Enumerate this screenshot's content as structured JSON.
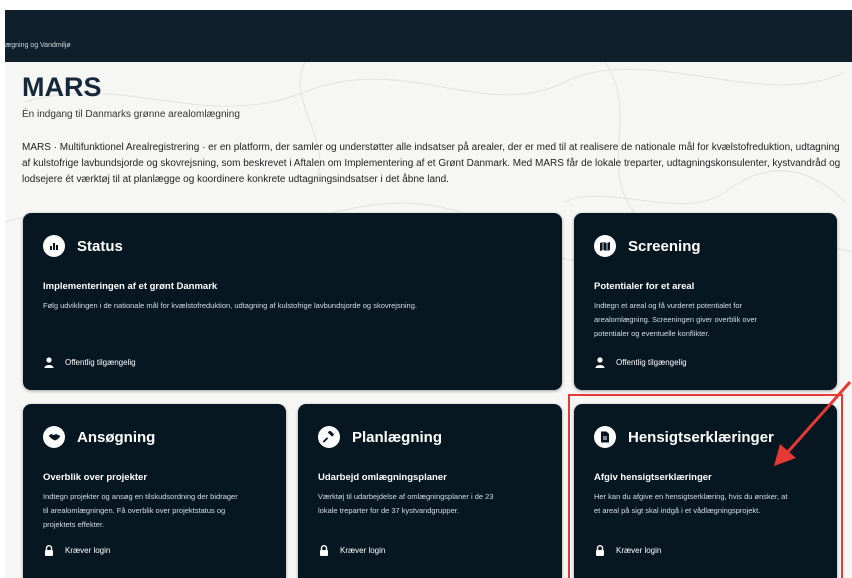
{
  "header": {
    "breadcrumb": "ægning og Vandmiljø"
  },
  "page": {
    "title": "MARS",
    "subtitle": "Én indgang til Danmarks grønne arealomlægning",
    "description": "MARS · Multifunktionel Arealregistrering · er en platform, der samler og understøtter alle indsatser på arealer, der er med til at realisere de nationale mål for kvælstofreduktion, udtagning af kulstofrige lavbundsjorde og skovrejsning, som beskrevet i Aftalen om Implementering af et Grønt Danmark. Med MARS får de lokale treparter, udtagningskonsulenter, kystvandråd og lodsejere ét værktøj til at planlægge og koordinere konkrete udtagningsindsatser i det åbne land."
  },
  "cards": {
    "status": {
      "title": "Status",
      "subtitle": "Implementeringen af et grønt Danmark",
      "body": "Følg udviklingen i de nationale mål for kvælstofreduktion, udtagning af kulstofrige lavbundsjorde og skovrejsning.",
      "footer": "Offentlig tilgængelig",
      "icon": "bar-chart-icon"
    },
    "screening": {
      "title": "Screening",
      "subtitle": "Potentialer for et areal",
      "body_lines": [
        "Indtegn et areal og få vurderet potentialet for",
        "arealomlægning. Screeningen giver overblik over",
        "potentialer og eventuelle konflikter."
      ],
      "footer": "Offentlig tilgængelig",
      "icon": "map-icon"
    },
    "ansogning": {
      "title": "Ansøgning",
      "subtitle": "Overblik over projekter",
      "body_lines": [
        "Indtegn projekter og ansøg en tilskudsordning der bidrager",
        "til arealomlægningen. Få overblik over projektstatus og",
        "projektets effekter."
      ],
      "footer": "Kræver login",
      "icon": "handshake-icon"
    },
    "planlaegning": {
      "title": "Planlægning",
      "subtitle": "Udarbejd omlægningsplaner",
      "body_lines": [
        "Værktøj til udarbejdelse af omlægningsplaner i de 23",
        "lokale treparter for de 37 kystvandgrupper."
      ],
      "footer": "Kræver login",
      "icon": "hammer-icon"
    },
    "hensigt": {
      "title": "Hensigtserklæringer",
      "subtitle": "Afgiv hensigtserklæringer",
      "body_lines": [
        "Her kan du afgive en hensigtserklæring, hvis du ønsker, at",
        "et areal på sigt skal indgå i et vådlægningsprojekt."
      ],
      "footer": "Kræver login",
      "icon": "document-icon"
    }
  },
  "colors": {
    "header_bg": "#0f1f2b",
    "card_bg": "#061722",
    "annotation": "#e53935"
  }
}
